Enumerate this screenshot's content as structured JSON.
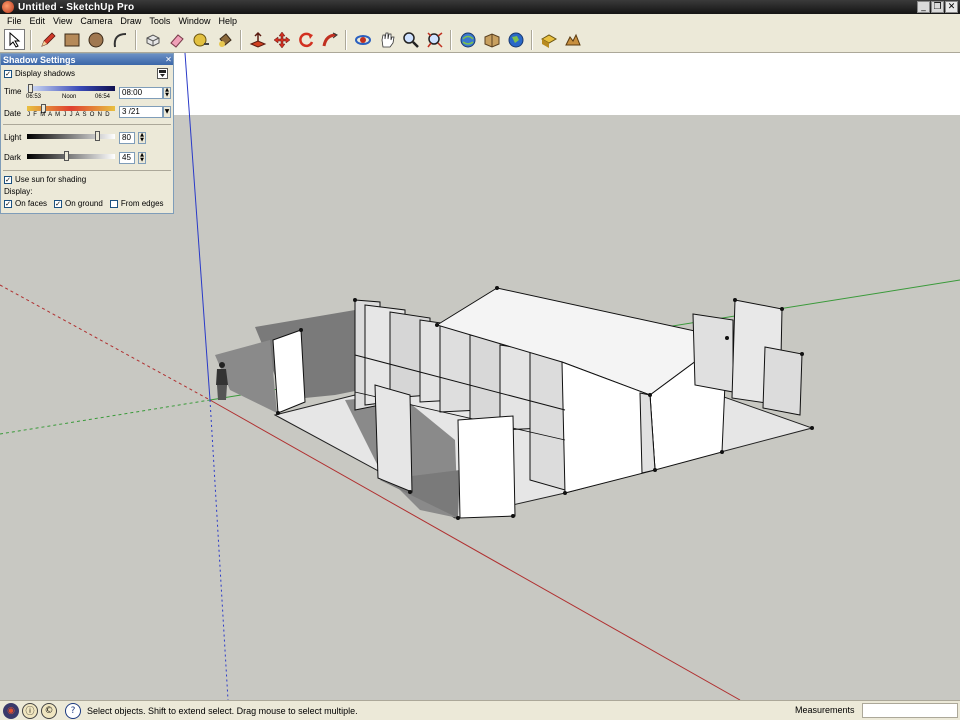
{
  "window": {
    "title": "Untitled - SketchUp Pro"
  },
  "menu": [
    "File",
    "Edit",
    "View",
    "Camera",
    "Draw",
    "Tools",
    "Window",
    "Help"
  ],
  "toolbar": {
    "tools": [
      "select-icon",
      "pencil-icon",
      "rectangle-icon",
      "circle-icon",
      "arc-icon",
      "make-component-icon",
      "eraser-icon",
      "tape-measure-icon",
      "paint-bucket-icon",
      "push-pull-icon",
      "move-icon",
      "rotate-icon",
      "follow-me-icon",
      "orbit-icon",
      "pan-icon",
      "zoom-icon",
      "zoom-extents-icon",
      "get-models-icon",
      "share-model-icon",
      "send-to-google-earth-icon",
      "get-photo-texture-icon",
      "toggle-terrain-icon"
    ]
  },
  "shadow_panel": {
    "title": "Shadow Settings",
    "display_shadows_label": "Display shadows",
    "display_shadows_checked": true,
    "time_label": "Time",
    "time_start": "06:53",
    "time_noon": "Noon",
    "time_end": "06:54",
    "time_value": "08:00",
    "date_label": "Date",
    "months": "J F M A M J J A S O N D",
    "date_value": "3 /21",
    "light_label": "Light",
    "light_value": "80",
    "dark_label": "Dark",
    "dark_value": "45",
    "use_sun_label": "Use sun for shading",
    "use_sun_checked": true,
    "display_label": "Display:",
    "on_faces_label": "On faces",
    "on_faces_checked": true,
    "on_ground_label": "On ground",
    "on_ground_checked": true,
    "from_edges_label": "From edges",
    "from_edges_checked": false
  },
  "status": {
    "message": "Select objects. Shift to extend select. Drag mouse to select multiple.",
    "measurements_label": "Measurements",
    "measurements_value": ""
  }
}
